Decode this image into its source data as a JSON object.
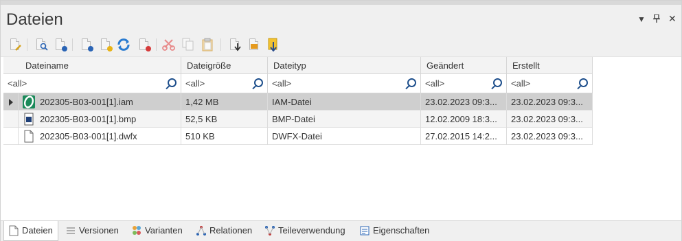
{
  "panel": {
    "title": "Dateien",
    "controls": {
      "dropdown": "▼",
      "pin": "ᵖ",
      "close": "✕"
    }
  },
  "toolbar": {
    "buttons": [
      {
        "icon": "new-document-icon"
      },
      {
        "icon": "find-document-icon"
      },
      {
        "icon": "document-blue-icon"
      },
      {
        "icon": "document-blue-2-icon"
      },
      {
        "icon": "document-yellow-icon"
      },
      {
        "icon": "refresh-icon"
      },
      {
        "icon": "document-delete-icon"
      },
      {
        "icon": "cut-icon"
      },
      {
        "icon": "copy-icon"
      },
      {
        "icon": "paste-icon"
      },
      {
        "icon": "import-document-icon"
      },
      {
        "icon": "export-document-icon"
      },
      {
        "icon": "archive-document-icon"
      }
    ]
  },
  "grid": {
    "columns": [
      "Dateiname",
      "Dateigröße",
      "Dateityp",
      "Geändert",
      "Erstellt"
    ],
    "filter_placeholder": "<all>",
    "rows": [
      {
        "name": "202305-B03-001[1].iam",
        "size": "1,42 MB",
        "type": "IAM-Datei",
        "changed": "23.02.2023 09:3...",
        "created": "23.02.2023 09:3...",
        "icon": "iam-file-icon",
        "selected": true
      },
      {
        "name": "202305-B03-001[1].bmp",
        "size": "52,5 KB",
        "type": "BMP-Datei",
        "changed": "12.02.2009 18:3...",
        "created": "23.02.2023 09:3...",
        "icon": "bmp-file-icon",
        "selected": false
      },
      {
        "name": "202305-B03-001[1].dwfx",
        "size": "510 KB",
        "type": "DWFX-Datei",
        "changed": "27.02.2015 14:2...",
        "created": "23.02.2023 09:3...",
        "icon": "dwfx-file-icon",
        "selected": false
      }
    ]
  },
  "tabs": [
    {
      "label": "Dateien",
      "icon": "document-icon",
      "active": true
    },
    {
      "label": "Versionen",
      "icon": "list-icon",
      "active": false
    },
    {
      "label": "Varianten",
      "icon": "variants-icon",
      "active": false
    },
    {
      "label": "Relationen",
      "icon": "relations-icon",
      "active": false
    },
    {
      "label": "Teileverwendung",
      "icon": "usage-icon",
      "active": false
    },
    {
      "label": "Eigenschaften",
      "icon": "properties-icon",
      "active": false
    }
  ],
  "colors": {
    "selected_row": "#cfcfcf",
    "accent_blue": "#1e4f8c",
    "iam_green": "#1b8a5a"
  }
}
